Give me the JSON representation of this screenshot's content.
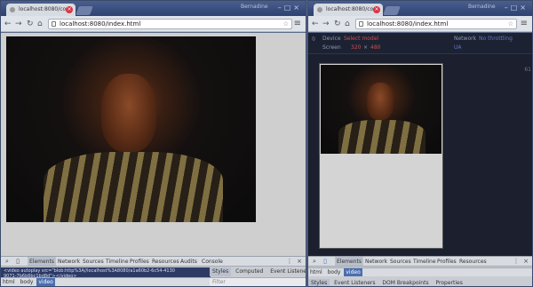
{
  "colors": {
    "titlebar": "#2e4170",
    "tab_close": "#dd3344",
    "active_crumb": "#4a6fb0",
    "devtools_panel": "#2d3a66",
    "emulation_bg": "#1b1f2e"
  },
  "left_window": {
    "tab_title": "localhost:8080/con",
    "user": "Bernadine",
    "url": "localhost:8080/index.html",
    "devtools": {
      "tabs": [
        "Elements",
        "Network",
        "Sources",
        "Timeline",
        "Profiles",
        "Resources",
        "Audits",
        "Console"
      ],
      "active_tab": "Elements",
      "source_lines": [
        "<video autoplay src=\"blob:http%3A//localhost%3A8080/a1a60b2-6c54-4130",
        "9071-7b6b6bc1bd8d\"></video>"
      ],
      "breadcrumbs": [
        "html",
        "body",
        "video"
      ],
      "style_tabs": [
        "Styles",
        "Computed",
        "Event Listeners"
      ],
      "filter_placeholder": "Filter"
    }
  },
  "right_window": {
    "tab_title": "localhost:8080/con",
    "user": "Bernadine",
    "url": "localhost:8080/index.html",
    "emulation": {
      "device_label": "Device",
      "device_value": "Select model",
      "screen_label": "Screen",
      "screen_w": "320",
      "screen_h": "480",
      "network_label": "Network",
      "network_value": "No throttling",
      "ua_value": "UA",
      "ruler_value": "61"
    },
    "devtools": {
      "tabs": [
        "Elements",
        "Network",
        "Sources",
        "Timeline",
        "Profiles",
        "Resources"
      ],
      "active_tab": "Elements",
      "breadcrumbs": [
        "html",
        "body",
        "video"
      ],
      "side_tabs": [
        "Styles",
        "Event Listeners",
        "DOM Breakpoints",
        "Properties"
      ]
    }
  }
}
